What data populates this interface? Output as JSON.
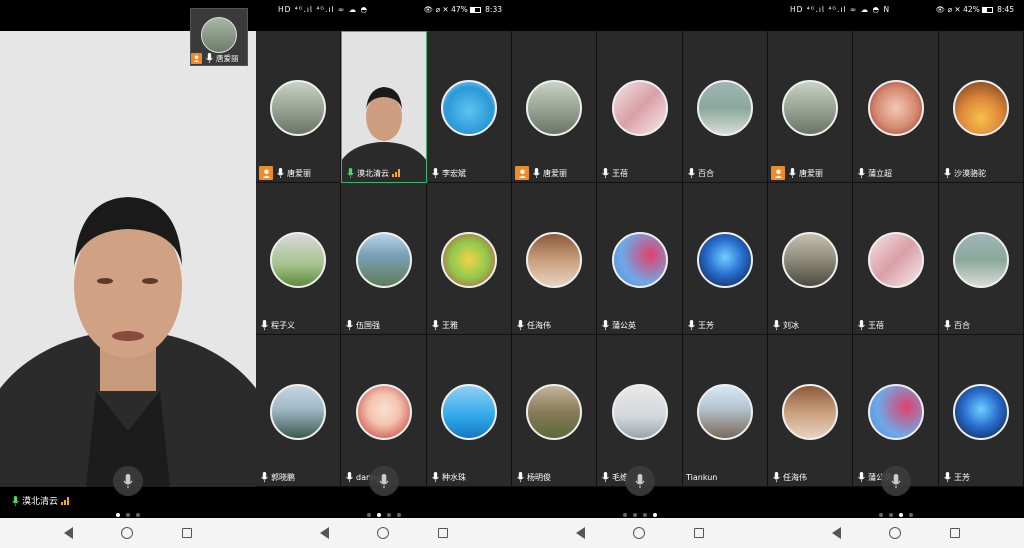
{
  "panels": [
    {
      "main_speaker": "漠北清云",
      "pip_name": "唐爱丽",
      "page": 0
    },
    {
      "status": {
        "left": "HD ⁴ᴳ.ıl ⁴ᴳ.ıl ∞ ☁ ◓",
        "battery": "47%",
        "time": "8:33"
      },
      "tiles": [
        {
          "name": "唐爱丽",
          "host": true,
          "avatar": "kids-walk"
        },
        {
          "name": "漠北清云",
          "active": true,
          "bars": true,
          "avatar": "man-video"
        },
        {
          "name": "李宏斌",
          "avatar": "dolphin"
        },
        {
          "name": "程子义",
          "avatar": "soccer"
        },
        {
          "name": "伍国强",
          "avatar": "landscape"
        },
        {
          "name": "王雅",
          "avatar": "fruit"
        },
        {
          "name": "郭晓鹏",
          "avatar": "lake"
        },
        {
          "name": "danny",
          "avatar": "cartoon-girl"
        },
        {
          "name": "种水珠",
          "avatar": "cartoon-boy"
        }
      ],
      "page": 1
    },
    {
      "tiles": [
        {
          "name": "唐爱丽",
          "host": true,
          "avatar": "kids-walk"
        },
        {
          "name": "王蓓",
          "avatar": "logo-pink"
        },
        {
          "name": "百合",
          "avatar": "geese"
        },
        {
          "name": "任海伟",
          "avatar": "reading"
        },
        {
          "name": "蒲公英",
          "avatar": "flowers"
        },
        {
          "name": "王芳",
          "avatar": "aurora"
        },
        {
          "name": "杨明俊",
          "avatar": "garden"
        },
        {
          "name": "毛维",
          "avatar": "silhouette"
        },
        {
          "name": "Tiankun",
          "nomic": true,
          "avatar": "person-hat"
        }
      ],
      "page": 3
    },
    {
      "status": {
        "left": "HD ⁴ᴳ.ıl ⁴ᴳ.ıl ∞ ☁ ◓ N",
        "battery": "42%",
        "time": "8:45"
      },
      "tiles": [
        {
          "name": "唐爱丽",
          "host": true,
          "avatar": "kids-walk"
        },
        {
          "name": "蒲立超",
          "avatar": "couple"
        },
        {
          "name": "沙漠骆驼",
          "avatar": "desert"
        },
        {
          "name": "刘冰",
          "avatar": "dusk-lake"
        },
        {
          "name": "王蓓",
          "avatar": "logo-pink"
        },
        {
          "name": "百合",
          "avatar": "geese"
        },
        {
          "name": "任海伟",
          "avatar": "reading"
        },
        {
          "name": "蒲公英",
          "avatar": "flowers"
        },
        {
          "name": "王芳",
          "avatar": "aurora"
        }
      ],
      "page": 2
    }
  ]
}
